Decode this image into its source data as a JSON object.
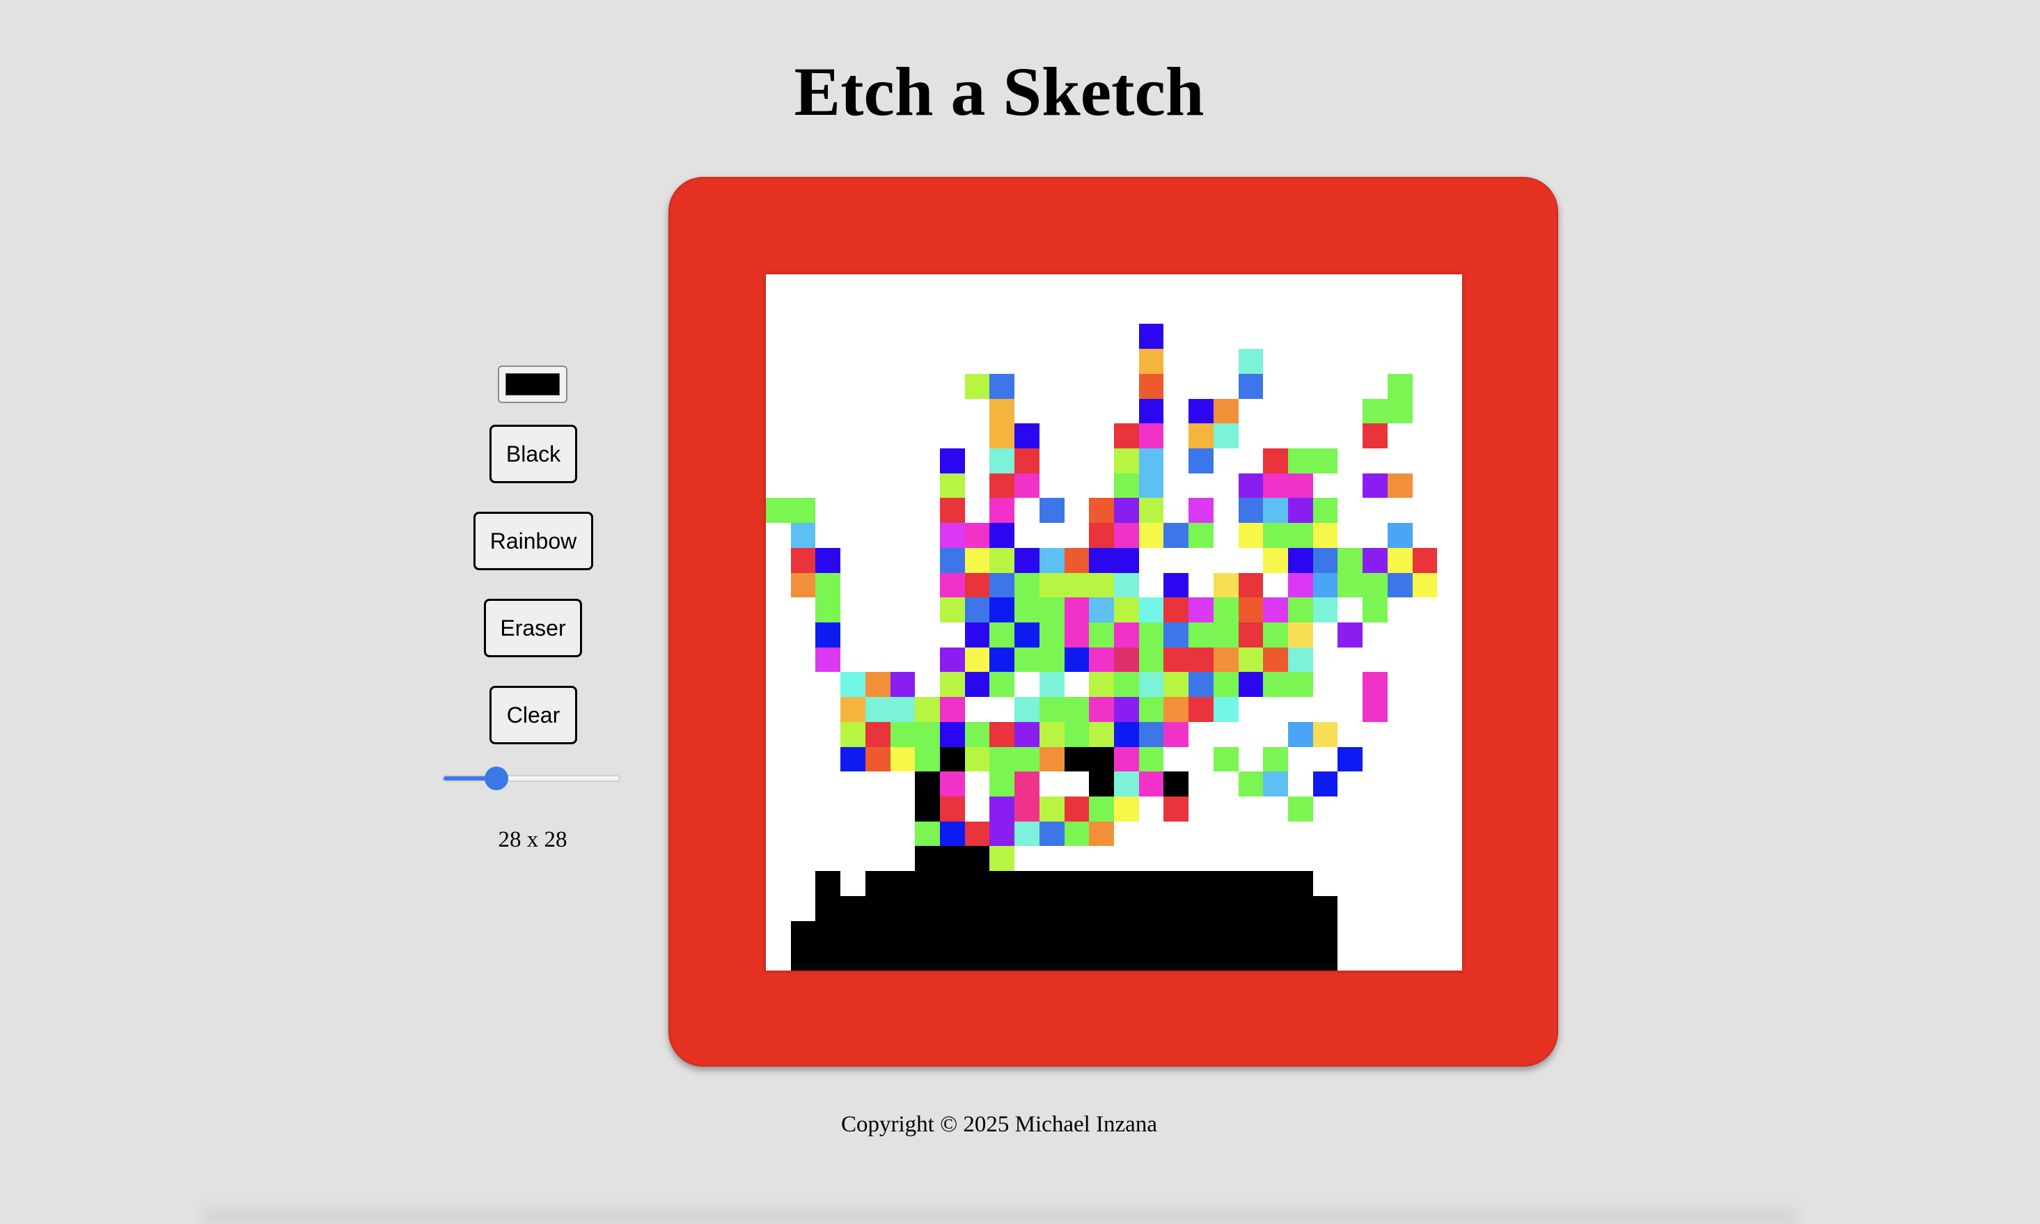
{
  "page": {
    "title": "Etch a Sketch",
    "footer": "Copyright © 2025 Michael Inzana",
    "background_color": "#e2e2e2",
    "frame_color": "#e53223"
  },
  "controls": {
    "color_picker": {
      "value": "#000000"
    },
    "buttons": {
      "black": "Black",
      "rainbow": "Rainbow",
      "eraser": "Eraser",
      "clear": "Clear"
    },
    "grid_size_slider": {
      "value": 28,
      "min": 1,
      "max": 100,
      "accent_color": "#3a78e6"
    },
    "grid_size_label": "28 x 28"
  },
  "canvas": {
    "columns": 28,
    "rows": 28,
    "background_color": "#ffffff",
    "palette": {
      "K": "#000000",
      "v": "#2a07f0",
      "b": "#0d1bf2",
      "B": "#3d76e8",
      "c": "#5cc0f2",
      "t": "#7cf2d8",
      "T": "#72f7e6",
      "g": "#7af552",
      "l": "#b7f542",
      "y": "#f7f74a",
      "Y": "#f7de55",
      "o": "#f2903a",
      "O": "#f5b43e",
      "r": "#e8343a",
      "R": "#ed5a2d",
      "p": "#f032c8",
      "P": "#da38f2",
      "m": "#f0338a",
      "u": "#8a1ef0",
      "M": "#e02e6a",
      "a": "#4aa6f5",
      "i": "#b4f03c"
    },
    "pixels": [
      "............................",
      "............................",
      "...............v............",
      "...............O...t........",
      "........lB.....R...B.....g..",
      ".........O.....v.vo.....gg..",
      ".........Ov...rp.Ot.....r...",
      ".......v.tr...lc.B..rgg.....",
      ".......l.rp...gc...upp..uo..",
      "gg.....r.p.B.Rul.P.Bcug.....",
      ".c.....Ppv...rpyBg.yggy..a..",
      ".rv....BylvcRvv.....yvBguyr.",
      ".og....prBglllt.v.Yr.PaggBy.",
      "..g....lBbggpclTrPgRPgt.g...",
      "..b.....vgbgpgpgBggrgY.u....",
      "..P....uybggbpMgrrolRt......",
      "...Tou.lvg.t.lgtlBgvgg..p...",
      "...Ottlp..tggpugorT.....p...",
      "...lrggvgrulglbBp....aY.....",
      "...bRygKlggoKKpg..g.g..b....",
      "......Kp.gm..KtpK..gc.b.....",
      "......Kr.umlrgy.r....g......",
      "......gbrutBgo..............",
      "......KKKl..................",
      "..K.KKKKKKKKKKKKKKKKKK......",
      "..KKKKKKKKKKKKKKKKKKKKK.....",
      ".KKKKKKKKKKKKKKKKKKKKKK.....",
      ".KKKKKKKKKKKKKKKKKKKKKK....."
    ]
  }
}
